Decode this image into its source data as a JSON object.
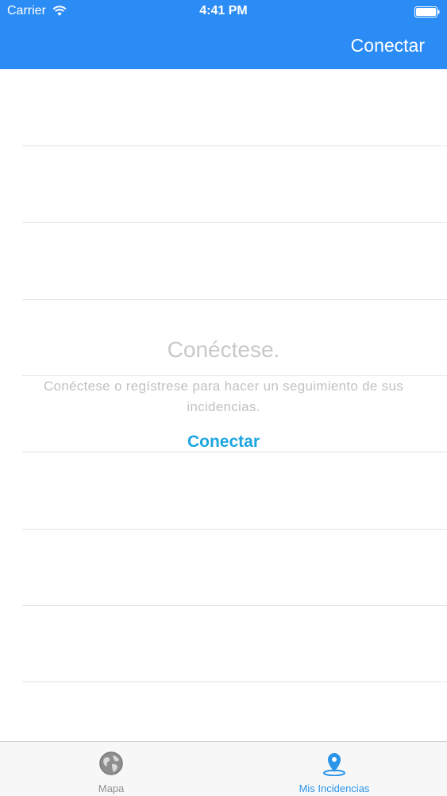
{
  "status_bar": {
    "carrier": "Carrier",
    "time": "4:41 PM"
  },
  "nav": {
    "connect_label": "Conectar"
  },
  "empty_state": {
    "title": "Conéctese.",
    "message": "Conéctese o regístrese para hacer un seguimiento de sus incidencias.",
    "connect_label": "Conectar"
  },
  "tab_bar": {
    "tabs": [
      {
        "label": "Mapa",
        "icon": "globe-icon",
        "selected": false
      },
      {
        "label": "Mis Incidencias",
        "icon": "location-pin-icon",
        "selected": true
      }
    ]
  },
  "colors": {
    "header": "#2b8cf5",
    "link": "#1ea5df",
    "tab_selected": "#2b95e9",
    "tab_unselected": "#8e8e8e"
  }
}
